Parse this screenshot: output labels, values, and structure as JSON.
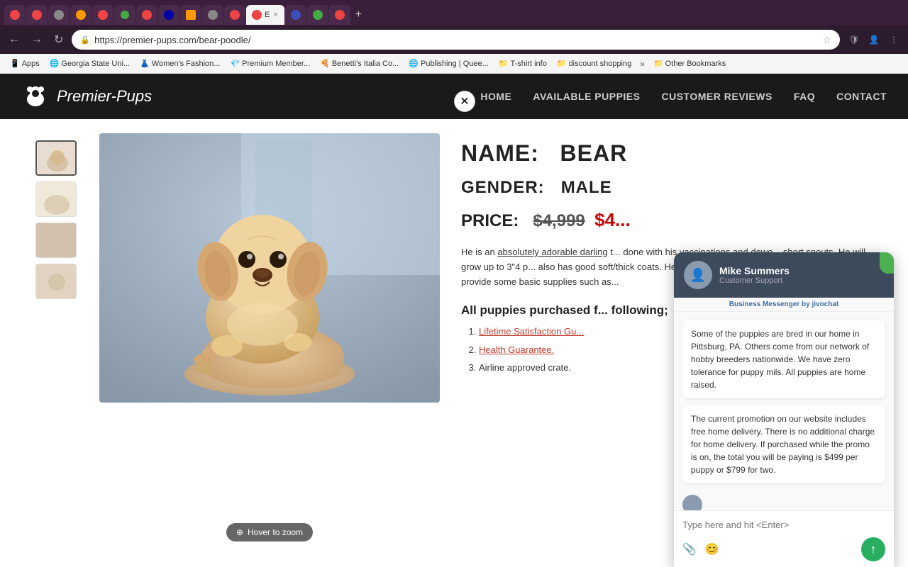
{
  "browser": {
    "tabs": [
      {
        "id": 1,
        "label": "",
        "active": false,
        "favicon_color": "#e44"
      },
      {
        "id": 2,
        "label": "",
        "active": false,
        "favicon_color": "#e44"
      },
      {
        "id": 3,
        "label": "",
        "active": false,
        "favicon_color": "#888"
      },
      {
        "id": 4,
        "label": "",
        "active": false,
        "favicon_color": "#f90"
      },
      {
        "id": 5,
        "label": "",
        "active": false,
        "favicon_color": "#e44"
      },
      {
        "id": 6,
        "label": "",
        "active": false,
        "favicon_color": "#4a4"
      },
      {
        "id": 7,
        "label": "",
        "active": false,
        "favicon_color": "#e44"
      },
      {
        "id": 8,
        "label": "",
        "active": false,
        "favicon_color": "#00a"
      },
      {
        "id": 9,
        "label": "",
        "active": false,
        "favicon_color": "#f90"
      },
      {
        "id": 10,
        "label": "E",
        "active": true,
        "favicon_color": "#e44"
      },
      {
        "id": 11,
        "label": "",
        "active": false,
        "favicon_color": "#3a4fb8"
      },
      {
        "id": 12,
        "label": "",
        "active": false,
        "favicon_color": "#4a4"
      },
      {
        "id": 13,
        "label": "",
        "active": false,
        "favicon_color": "#e44"
      }
    ],
    "url": "https://premier-pups.com/bear-poodle/",
    "new_tab_label": "+"
  },
  "bookmarks": [
    {
      "label": "Apps",
      "icon": "📱"
    },
    {
      "label": "Georgia State Uni...",
      "icon": "🌐"
    },
    {
      "label": "Women's Fashion...",
      "icon": "👗"
    },
    {
      "label": "Premium Member...",
      "icon": "💎"
    },
    {
      "label": "Benetti's Italia Co...",
      "icon": "🍕"
    },
    {
      "label": "Publishing | Quee...",
      "icon": "🌐"
    },
    {
      "label": "T-shirt info",
      "icon": "📁"
    },
    {
      "label": "discount shopping",
      "icon": "📁"
    },
    {
      "label": "Other Bookmarks",
      "icon": "📁"
    }
  ],
  "site": {
    "title": "Premier-Pups",
    "logo_alt": "Premier Pups Logo",
    "nav": [
      {
        "label": "HOME"
      },
      {
        "label": "AVAILABLE PUPPIES"
      },
      {
        "label": "CUSTOMER REVIEWS"
      },
      {
        "label": "FAQ"
      },
      {
        "label": "CONTACT"
      }
    ]
  },
  "product": {
    "name_label": "NAME:",
    "name_value": "BEAR",
    "gender_label": "GENDER:",
    "gender_value": "MALE",
    "price_label": "PRICE:",
    "price_original": "$4,999",
    "price_sale": "$4...",
    "description": "He is an absolutely adorable darling t... done with his vaccinations and dewo... short snouts. He will grow up to 3\"4 p... also has good soft/thick coats. He is v... comes with good health guarantee w... provide some basic supplies such as...",
    "section_title": "All puppies purchased f... following;",
    "list_items": [
      {
        "text": "Lifetime Satisfaction Gu...",
        "is_link": true
      },
      {
        "text": "Health Guarantee.",
        "is_link": true
      },
      {
        "text": "Airline approved crate.",
        "is_link": false
      }
    ],
    "hover_zoom_label": "Hover to zoom"
  },
  "chat": {
    "agent_name": "Mike Summers",
    "agent_role": "Customer Support",
    "powered_by": "Business Messenger by",
    "powered_brand": "jivochat",
    "messages": [
      {
        "text": "Some of the puppies are bred in our home in Pittsburg, PA. Others come from our network of hobby breeders nationwide. We have zero tolerance for puppy mils. All puppies are home raised."
      },
      {
        "text": "The current promotion on our website includes free home delivery. There is no additional charge for home delivery. If purchased while the promo is on, the total you will be paying is $499 per puppy or $799 for two."
      }
    ],
    "input_placeholder": "Type here and hit <Enter>",
    "send_icon": "↑"
  }
}
